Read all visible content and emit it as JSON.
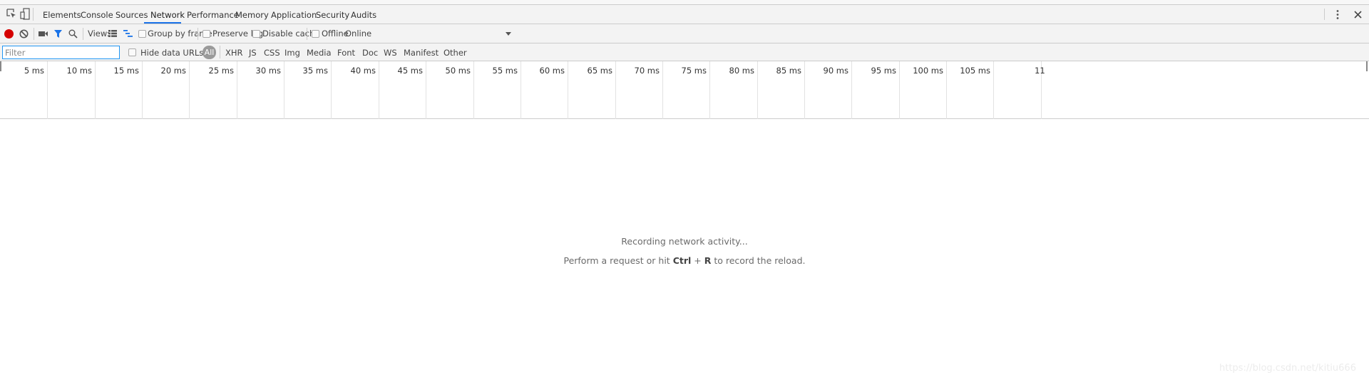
{
  "tabs": [
    {
      "label": "Elements"
    },
    {
      "label": "Console"
    },
    {
      "label": "Sources"
    },
    {
      "label": "Network",
      "active": true
    },
    {
      "label": "Performance"
    },
    {
      "label": "Memory"
    },
    {
      "label": "Application"
    },
    {
      "label": "Security"
    },
    {
      "label": "Audits"
    }
  ],
  "toolbar": {
    "record_color": "#d50000",
    "view_label": "View:",
    "group_by_frame": "Group by frame",
    "preserve_log": "Preserve log",
    "disable_cache": "Disable cache",
    "offline": "Offline",
    "throttle": "Online",
    "accent": "#1a73e8"
  },
  "filterbar": {
    "placeholder": "Filter",
    "hide_data_urls": "Hide data URLs",
    "types": [
      "All",
      "XHR",
      "JS",
      "CSS",
      "Img",
      "Media",
      "Font",
      "Doc",
      "WS",
      "Manifest",
      "Other"
    ]
  },
  "timeline": {
    "ticks": [
      "5 ms",
      "10 ms",
      "15 ms",
      "20 ms",
      "25 ms",
      "30 ms",
      "35 ms",
      "40 ms",
      "45 ms",
      "50 ms",
      "55 ms",
      "60 ms",
      "65 ms",
      "70 ms",
      "75 ms",
      "80 ms",
      "85 ms",
      "90 ms",
      "95 ms",
      "100 ms",
      "105 ms",
      "11"
    ]
  },
  "empty_state": {
    "line1": "Recording network activity...",
    "line2_pre": "Perform a request or hit ",
    "key1": "Ctrl",
    "plus": " + ",
    "key2": "R",
    "line2_post": " to record the reload."
  },
  "watermark": "https://blog.csdn.net/kitiu666"
}
